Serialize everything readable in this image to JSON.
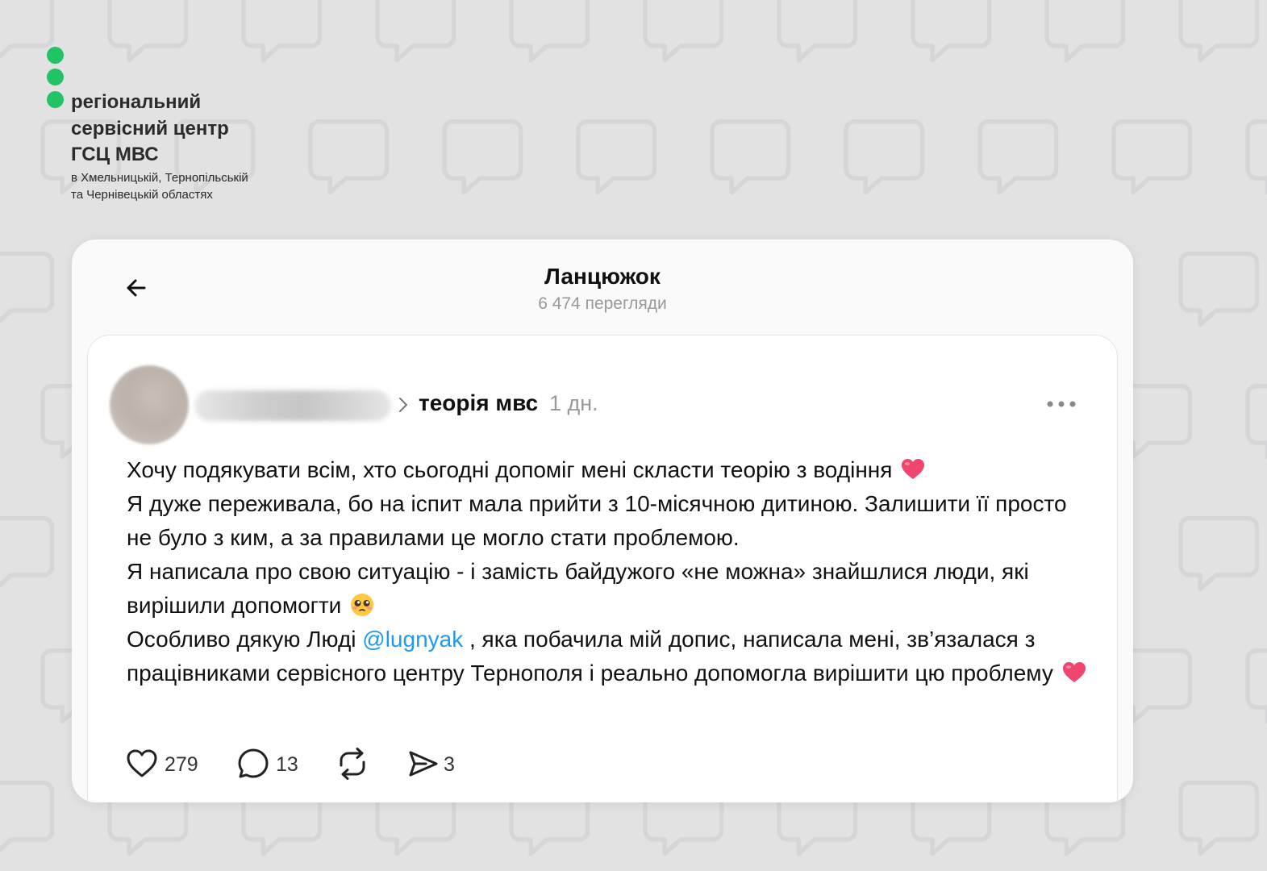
{
  "brand": {
    "line1": "регіональний",
    "line2": "сервісний центр",
    "line3": "ГСЦ МВС",
    "small1": "в Хмельницькій, Тернопільській",
    "small2": "та Чернівецькій областях",
    "accent_color": "#22c366"
  },
  "header": {
    "title": "Ланцюжок",
    "views": "6 474 перегляди",
    "back_icon": "arrow-left-icon"
  },
  "post": {
    "topic": "теорія мвс",
    "time": "1 дн.",
    "more_icon": "more-horizontal-icon",
    "text": {
      "p1": "Хочу подякувати всім, хто сьогодні допоміг мені скласти теорію з водіння",
      "p2": "Я дуже переживала, бо на іспит мала прийти з 10-місячною дитиною. Залишити її просто не було з ким, а за правилами це могло стати проблемою.",
      "p3": "Я написала про свою ситуацію - і замість байдужого «не можна» знайшлися люди, які вирішили допомогти",
      "p4_before": "Особливо дякую Люді ",
      "mention": "@lugnyak",
      "p4_after": " , яка побачила мій допис, написала мені, зв’язалася з працівниками сервісного центру Тернополя і реально допомогла вирішити цю проблему"
    },
    "mention_color": "#1d9bf0",
    "actions": {
      "likes": "279",
      "comments": "13",
      "shares": "3"
    }
  }
}
